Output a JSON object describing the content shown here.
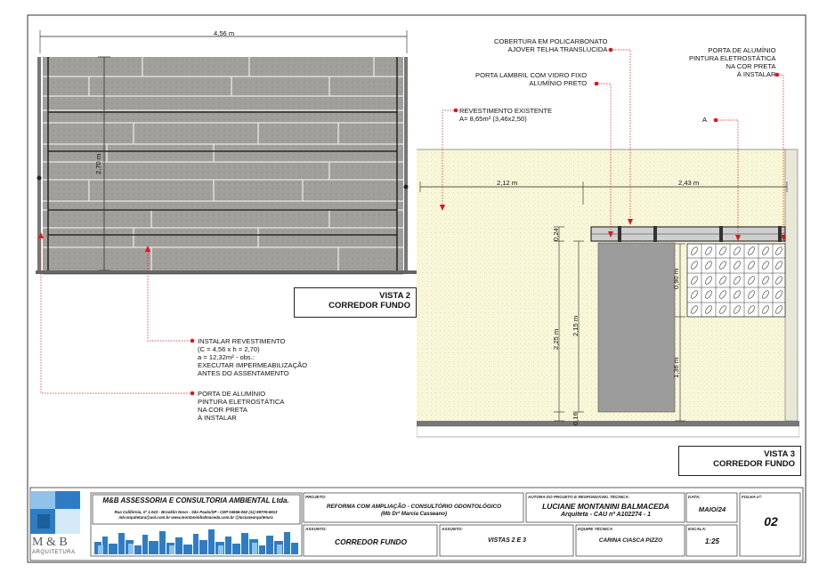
{
  "vista2": {
    "width_dim": "4,56 m",
    "height_dim": "2,70 m",
    "title_line1": "VISTA 2",
    "title_line2": "CORREDOR FUNDO",
    "note_revestimento": "INSTALAR REVESTIMENTO\n(C = 4,56 x h = 2,70)\na = 12,32m² - obs.:\nEXECUTAR IMPERMEABILIZAÇÃO\nANTES DO ASSENTAMENTO",
    "note_porta": "PORTA DE ALUMÍNIO\nPINTURA ELETROSTÁTICA\nNA COR PRETA\nÀ INSTALAR"
  },
  "vista3": {
    "title_line1": "VISTA 3",
    "title_line2": "CORREDOR FUNDO",
    "note_cobertura": "COBERTURA EM POLICARBONATO\nAJOVER TELHA TRANSLUCIDA",
    "note_porta_lambril": "PORTA LAMBRIL COM VIDRO FIXO\nALUMÍNIO PRETO",
    "note_revestimento": "REVESTIMENTO EXISTENTE\nA= 8,65m² (3,46x2,50)",
    "note_porta_aluminio": "PORTA DE ALUMÍNIO\nPINTURA ELETROSTÁTICA\nNA COR PRETA\nÀ INSTALAR",
    "note_a": "A",
    "dim_left": "2,12 m",
    "dim_right": "2,43 m",
    "dim_024": "0,24",
    "dim_225": "2,25 m",
    "dim_215": "2,15 m",
    "dim_016": "0,16",
    "dim_090": "0,90 m",
    "dim_136": "1,36 m"
  },
  "titleblock": {
    "logo_text": "M & B",
    "logo_sub": "ARQUITETURA",
    "company": "M&B ASSESSORIA E CONSULTORIA AMBIENTAL Ltda.",
    "address1": "Rua Califórnia, nº 1.043 - Brooklin Novo - São Paulo/SP - CEP 04566-062   (11) 99709-6913",
    "address2": "mb-arquitetura@uol.com.br     www.montaninibalmaceda.com.br     @lucianearquitetura",
    "projeto_label": "PROJETO:",
    "projeto_line1": "REFORMA COM AMPLIAÇÃO - CONSULTÓRIO ODONTOLÓGICO",
    "projeto_line2": "(Mb Drª Marcia Casseano)",
    "autor_label": "AUTORA DO PROJETO E RESPONSÁVEL TÉCNICA:",
    "autor_name": "LUCIANE MONTANINI BALMACEDA",
    "autor_cau": "Arquiteta - CAU nº A102274 - 1",
    "data_label": "DATA:",
    "data_value": "MAIO/24",
    "folha_label": "FOLHA nº:",
    "folha_value": "02",
    "assunto_label": "ASSUNTO:",
    "assunto_value": "CORREDOR FUNDO",
    "assunto2_label": "ASSUNTO:",
    "assunto2_value": "VISTAS 2 E 3",
    "equipe_label": "EQUIPE TÉCNICA",
    "equipe_value": "CARINA CIASCA PIZZO",
    "escala_label": "ESCALA:",
    "escala_value": "1:25"
  },
  "colors": {
    "accent_red": "#e0141b",
    "tile_gray": "#9a9a98",
    "wall_yellow": "#f7f6d6",
    "logo_blue": "#2e7dc4",
    "logo_light": "#8fc3ea"
  }
}
